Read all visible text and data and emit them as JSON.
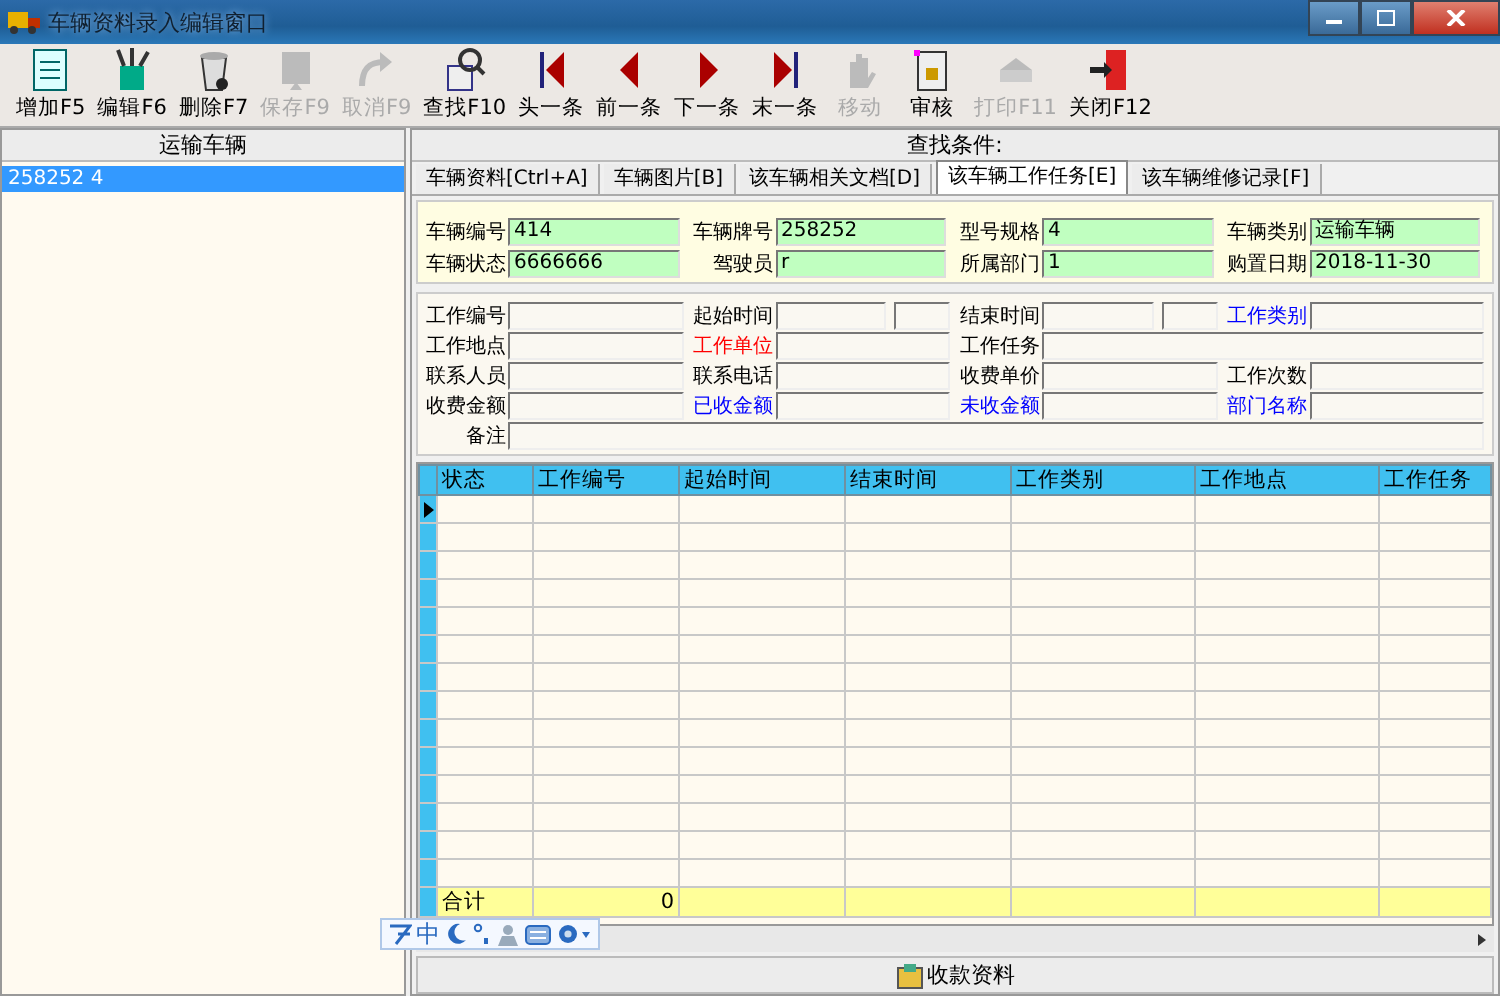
{
  "window": {
    "title": "车辆资料录入编辑窗口"
  },
  "toolbar": [
    {
      "kind": "add",
      "label": "增加F5",
      "disabled": false
    },
    {
      "kind": "edit",
      "label": "编辑F6",
      "disabled": false
    },
    {
      "kind": "delete",
      "label": "删除F7",
      "disabled": false
    },
    {
      "kind": "save",
      "label": "保存F9",
      "disabled": true
    },
    {
      "kind": "undo",
      "label": "取消F9",
      "disabled": true
    },
    {
      "kind": "find",
      "label": "查找F10",
      "disabled": false
    },
    {
      "kind": "first",
      "label": "头一条",
      "disabled": false
    },
    {
      "kind": "prev",
      "label": "前一条",
      "disabled": false
    },
    {
      "kind": "next",
      "label": "下一条",
      "disabled": false
    },
    {
      "kind": "last",
      "label": "末一条",
      "disabled": false
    },
    {
      "kind": "move",
      "label": "移动",
      "disabled": true
    },
    {
      "kind": "audit",
      "label": "审核",
      "disabled": false
    },
    {
      "kind": "print",
      "label": "打印F11",
      "disabled": true
    },
    {
      "kind": "exit",
      "label": "关闭F12",
      "disabled": false
    }
  ],
  "left_panel": {
    "header": "运输车辆",
    "items": [
      {
        "label": "258252 4",
        "selected": true
      }
    ]
  },
  "search_header": "查找条件:",
  "tabs": [
    {
      "label": "车辆资料[Ctrl+A]",
      "selected": false
    },
    {
      "label": "车辆图片[B]",
      "selected": false
    },
    {
      "label": "该车辆相关文档[D]",
      "selected": false
    },
    {
      "label": "该车辆工作任务[E]",
      "selected": true
    },
    {
      "label": "该车辆维修记录[F]",
      "selected": false
    }
  ],
  "vehicle_fields": [
    {
      "label": "车辆编号",
      "value": "414"
    },
    {
      "label": "车辆牌号",
      "value": "258252"
    },
    {
      "label": "型号规格",
      "value": "4"
    },
    {
      "label": "车辆类别",
      "value": "运输车辆"
    },
    {
      "label": "车辆状态",
      "value": "6666666"
    },
    {
      "label": "驾驶员",
      "value": "r"
    },
    {
      "label": "所属部门",
      "value": "1"
    },
    {
      "label": "购置日期",
      "value": "2018-11-30"
    }
  ],
  "task_fields": [
    {
      "label": "工作编号",
      "kind": "text",
      "color": "#000000"
    },
    {
      "label": "起始时间",
      "kind": "datetime",
      "color": "#000000"
    },
    {
      "label": "结束时间",
      "kind": "datetime",
      "color": "#000000"
    },
    {
      "label": "工作类别",
      "kind": "text",
      "color": "#0000ff"
    },
    {
      "label": "工作地点",
      "kind": "text",
      "color": "#000000"
    },
    {
      "label": "工作单位",
      "kind": "text",
      "color": "#ff0000"
    },
    {
      "label": "工作任务",
      "kind": "wide",
      "color": "#000000"
    },
    {
      "label": "联系人员",
      "kind": "text",
      "color": "#000000"
    },
    {
      "label": "联系电话",
      "kind": "text",
      "color": "#000000"
    },
    {
      "label": "收费单价",
      "kind": "text",
      "color": "#000000"
    },
    {
      "label": "工作次数",
      "kind": "text",
      "color": "#000000"
    },
    {
      "label": "收费金额",
      "kind": "text",
      "color": "#000000"
    },
    {
      "label": "已收金额",
      "kind": "text",
      "color": "#0000ff"
    },
    {
      "label": "未收金额",
      "kind": "text",
      "color": "#0000ff"
    },
    {
      "label": "部门名称",
      "kind": "text",
      "color": "#0000ff"
    },
    {
      "label": "备注",
      "kind": "full",
      "color": "#000000"
    }
  ],
  "grid": {
    "columns": [
      "状态",
      "工作编号",
      "起始时间",
      "结束时间",
      "工作类别",
      "工作地点",
      "工作任务"
    ],
    "total_row": [
      "合计",
      "0"
    ]
  },
  "ime_bar": {
    "mode": "中"
  },
  "bottom_button": {
    "label": "收款资料"
  }
}
